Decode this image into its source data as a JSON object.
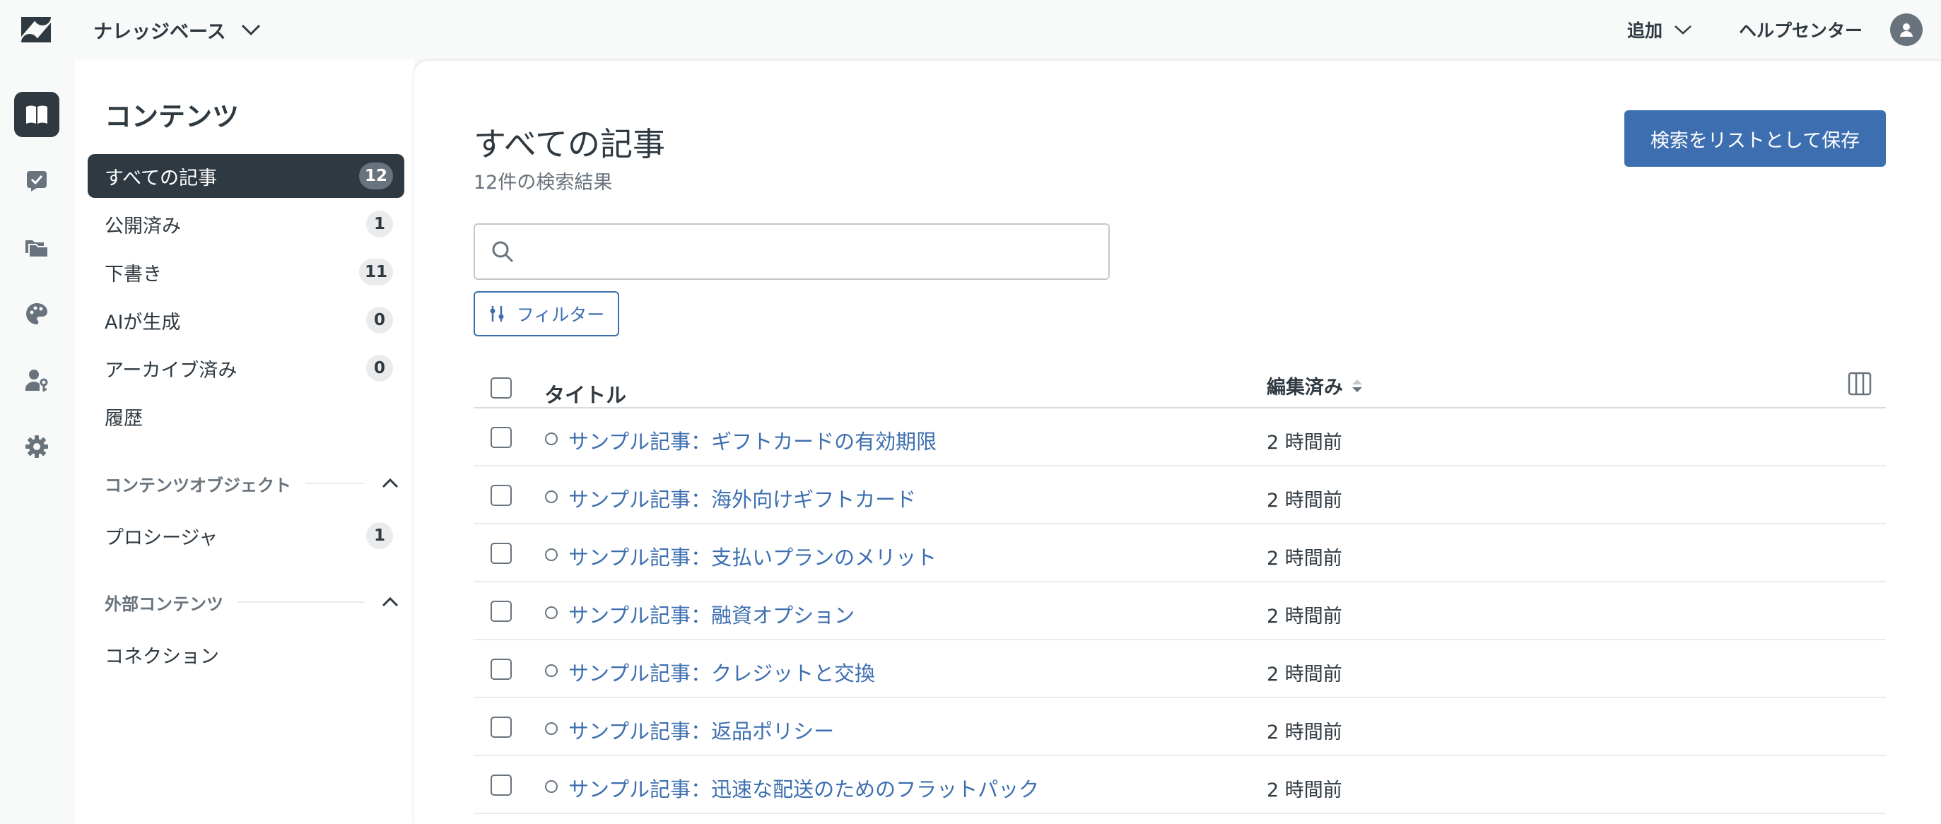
{
  "header": {
    "product_name": "ナレッジベース",
    "add_label": "追加",
    "help_center_label": "ヘルプセンター"
  },
  "rail": {
    "items": [
      {
        "icon": "book-icon",
        "active": true
      },
      {
        "icon": "checklist-icon",
        "active": false
      },
      {
        "icon": "folders-icon",
        "active": false
      },
      {
        "icon": "palette-icon",
        "active": false
      },
      {
        "icon": "user-key-icon",
        "active": false
      },
      {
        "icon": "gear-icon",
        "active": false
      }
    ]
  },
  "nav": {
    "title": "コンテンツ",
    "items": [
      {
        "label": "すべての記事",
        "count": "12"
      },
      {
        "label": "公開済み",
        "count": "1"
      },
      {
        "label": "下書き",
        "count": "11"
      },
      {
        "label": "AIが生成",
        "count": "0"
      },
      {
        "label": "アーカイブ済み",
        "count": "0"
      },
      {
        "label": "履歴"
      }
    ],
    "content_objects": {
      "heading": "コンテンツオブジェクト",
      "items": [
        {
          "label": "プロシージャ",
          "count": "1"
        }
      ]
    },
    "external": {
      "heading": "外部コンテンツ",
      "items": [
        {
          "label": "コネクション"
        }
      ]
    }
  },
  "main": {
    "title": "すべての記事",
    "result_count": "12件の検索結果",
    "save_button": "検索をリストとして保存",
    "search": {
      "value": "",
      "placeholder": ""
    },
    "filter_button": "フィルター",
    "table": {
      "headers": {
        "title": "タイトル",
        "edited": "編集済み"
      },
      "rows": [
        {
          "title": "サンプル記事：ギフトカードの有効期限",
          "edited": "2 時間前"
        },
        {
          "title": "サンプル記事：海外向けギフトカード",
          "edited": "2 時間前"
        },
        {
          "title": "サンプル記事：支払いプランのメリット",
          "edited": "2 時間前"
        },
        {
          "title": "サンプル記事：融資オプション",
          "edited": "2 時間前"
        },
        {
          "title": "サンプル記事：クレジットと交換",
          "edited": "2 時間前"
        },
        {
          "title": "サンプル記事：返品ポリシー",
          "edited": "2 時間前"
        },
        {
          "title": "サンプル記事：迅速な配送のためのフラットパック",
          "edited": "2 時間前"
        }
      ]
    }
  },
  "colors": {
    "accent": "#3d6fb0",
    "dark": "#2f3941",
    "muted": "#68737d"
  }
}
